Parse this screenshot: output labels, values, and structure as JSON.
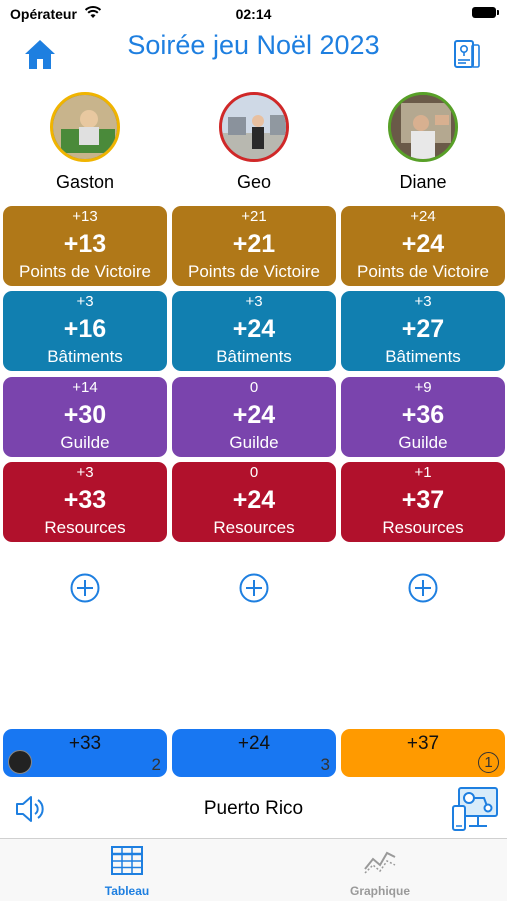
{
  "status_bar": {
    "carrier": "Opérateur",
    "time": "02:14"
  },
  "header": {
    "title": "Soirée jeu Noël 2023",
    "home_icon": "house-icon",
    "doc_icon": "document-pin-icon"
  },
  "players": [
    {
      "name": "Gaston",
      "border_color": "#f0b400",
      "avatar_bg": "#7a6a48"
    },
    {
      "name": "Geo",
      "border_color": "#d02828",
      "avatar_bg": "#9aa6b4"
    },
    {
      "name": "Diane",
      "border_color": "#58a028",
      "avatar_bg": "#6a5a48"
    }
  ],
  "rows": [
    {
      "category": "Points de Victoire",
      "color": "#b07818",
      "cells": [
        {
          "delta": "+13",
          "total": "+13"
        },
        {
          "delta": "+21",
          "total": "+21"
        },
        {
          "delta": "+24",
          "total": "+24"
        }
      ]
    },
    {
      "category": "Bâtiments",
      "color": "#117fb0",
      "cells": [
        {
          "delta": "+3",
          "total": "+16"
        },
        {
          "delta": "+3",
          "total": "+24"
        },
        {
          "delta": "+3",
          "total": "+27"
        }
      ]
    },
    {
      "category": "Guilde",
      "color": "#7a44ad",
      "cells": [
        {
          "delta": "+14",
          "total": "+30"
        },
        {
          "delta": "0",
          "total": "+24"
        },
        {
          "delta": "+9",
          "total": "+36"
        }
      ]
    },
    {
      "category": "Resources",
      "color": "#b1112c",
      "cells": [
        {
          "delta": "+3",
          "total": "+33"
        },
        {
          "delta": "0",
          "total": "+24"
        },
        {
          "delta": "+1",
          "total": "+37"
        }
      ]
    }
  ],
  "scores": [
    {
      "value": "+33",
      "rank": "2",
      "color": "#1877f2"
    },
    {
      "value": "+24",
      "rank": "3",
      "color": "#1877f2"
    },
    {
      "value": "+37",
      "rank": "1",
      "color": "#ff9a00"
    }
  ],
  "footer": {
    "game_name": "Puerto Rico",
    "speaker_icon": "speaker-icon",
    "graph_icon": "presentation-graph-icon"
  },
  "tabs": [
    {
      "label": "Tableau",
      "icon": "table-icon",
      "active": true,
      "color": "#1e7fe0"
    },
    {
      "label": "Graphique",
      "icon": "line-chart-icon",
      "active": false,
      "color": "#9a9a9a"
    }
  ]
}
